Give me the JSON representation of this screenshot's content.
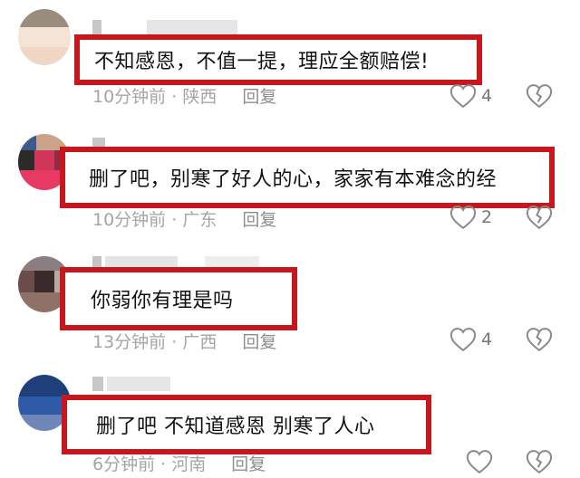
{
  "comments": [
    {
      "text": "不知感恩，不值一提，理应全额赔偿!",
      "time": "10分钟前",
      "location": "陕西",
      "reply_label": "回复",
      "likes": "4"
    },
    {
      "text": "删了吧，别寒了好人的心，家家有本难念的经",
      "time": "10分钟前",
      "location": "广东",
      "reply_label": "回复",
      "likes": "2"
    },
    {
      "text": "你弱你有理是吗",
      "time": "13分钟前",
      "location": "广西",
      "reply_label": "回复",
      "likes": "4"
    },
    {
      "text": "删了吧  不知道感恩   别寒了人心",
      "time": "6分钟前",
      "location": "河南",
      "reply_label": "回复",
      "likes": ""
    }
  ],
  "separator": " · ",
  "icons": {
    "like": "heart-outline-icon",
    "dislike": "broken-heart-icon"
  },
  "colors": {
    "highlight_border": "#c8161d",
    "meta_text": "#a5a5a5"
  }
}
